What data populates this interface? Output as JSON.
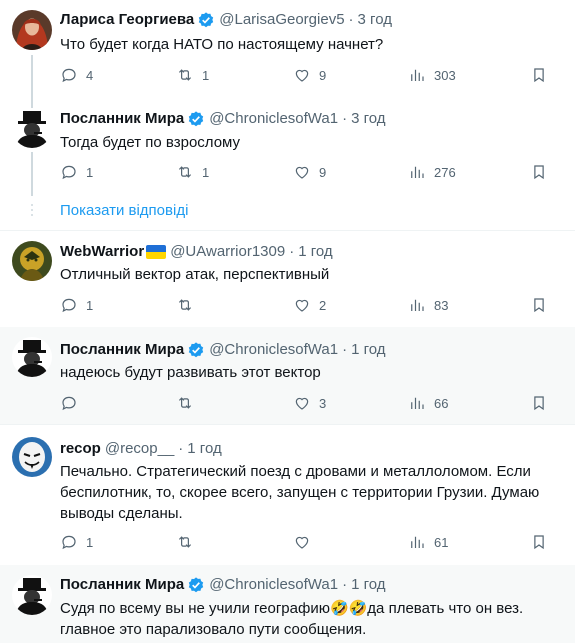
{
  "show_replies_label": "Показати відповіді",
  "tweets": [
    {
      "name": "Лариса Георгиева",
      "handle": "@LarisaGeorgiev5",
      "time": "3 год",
      "text": "Что будет когда НАТО по настоящему начнет?",
      "replies": "4",
      "retweets": "1",
      "likes": "9",
      "views": "303",
      "verified": true,
      "avatar_icon": "woman-red-hair-avatar"
    },
    {
      "name": "Посланник Мира",
      "handle": "@ChroniclesofWa1",
      "time": "3 год",
      "text": "Тогда будет по взрослому",
      "replies": "1",
      "retweets": "1",
      "likes": "9",
      "views": "276",
      "verified": true,
      "avatar_icon": "churchill-avatar"
    },
    {
      "name": "WebWarrior",
      "handle": "@UAwarrior1309",
      "time": "1 год",
      "text": "Отличный вектор атак, перспективный",
      "replies": "1",
      "retweets": "",
      "likes": "2",
      "views": "83",
      "verified": false,
      "avatar_icon": "warrior-avatar"
    },
    {
      "name": "Посланник Мира",
      "handle": "@ChroniclesofWa1",
      "time": "1 год",
      "text": "надеюсь будут развивать этот вектор",
      "replies": "",
      "retweets": "",
      "likes": "3",
      "views": "66",
      "verified": true,
      "avatar_icon": "churchill-avatar"
    },
    {
      "name": "recop",
      "handle": "@recop__",
      "time": "1 год",
      "text": "Печально. Стратегический поезд с дровами и металлоломом. Если беспилотник, то, скорее всего, запущен с территории Грузии. Думаю выводы сделаны.",
      "replies": "1",
      "retweets": "",
      "likes": "",
      "views": "61",
      "verified": false,
      "avatar_icon": "mask-avatar"
    },
    {
      "name": "Посланник Мира",
      "handle": "@ChroniclesofWa1",
      "time": "1 год",
      "text_line1": "Судя по всему вы не учили географию🤣🤣да плевать что он вез.",
      "text_line2": "главное это парализовало пути сообщения.",
      "verified": true,
      "avatar_icon": "churchill-avatar"
    }
  ],
  "colors": {
    "accent": "#1d9bf0",
    "muted": "#536471",
    "highlight_bg": "#f7f9f9",
    "flag_blue": "#1f6fd6",
    "flag_yellow": "#ffd500"
  }
}
